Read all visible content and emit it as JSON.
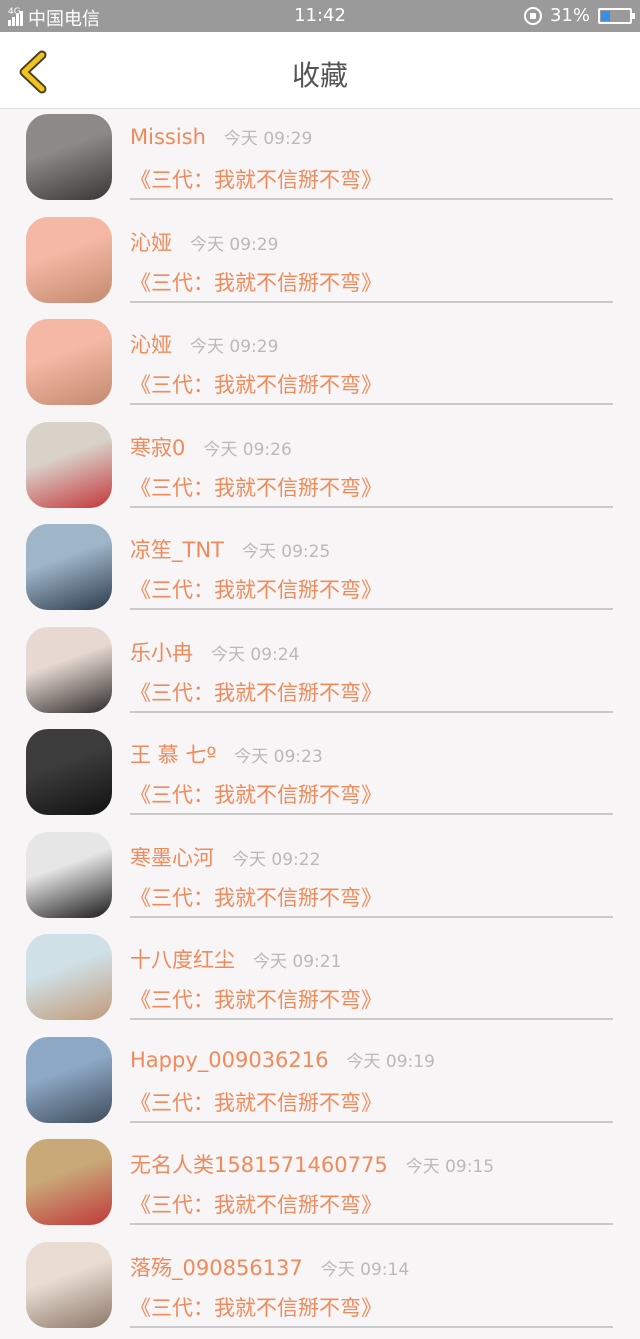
{
  "status_bar": {
    "network": "4G",
    "carrier": "中国电信",
    "time": "11:42",
    "battery": "31%",
    "battery_level": 0.31
  },
  "header": {
    "title": "收藏",
    "accent_color": "#f0c420"
  },
  "favorites": [
    {
      "name": "Missish",
      "time": "今天 09:29",
      "book": "《三代：我就不信掰不弯》",
      "avatar_colors": [
        "#8b8a86",
        "#3a3633"
      ]
    },
    {
      "name": "沁娅",
      "time": "今天 09:29",
      "book": "《三代：我就不信掰不弯》",
      "avatar_colors": [
        "#f4b8a4",
        "#c28a6f"
      ]
    },
    {
      "name": "沁娅",
      "time": "今天 09:29",
      "book": "《三代：我就不信掰不弯》",
      "avatar_colors": [
        "#f4b8a4",
        "#c28a6f"
      ]
    },
    {
      "name": "寒寂0",
      "time": "今天 09:26",
      "book": "《三代：我就不信掰不弯》",
      "avatar_colors": [
        "#d9d2c9",
        "#c4363a"
      ]
    },
    {
      "name": "凉笙_TNT",
      "time": "今天 09:25",
      "book": "《三代：我就不信掰不弯》",
      "avatar_colors": [
        "#9fb6c8",
        "#2c3b4c"
      ]
    },
    {
      "name": "乐小冉",
      "time": "今天 09:24",
      "book": "《三代：我就不信掰不弯》",
      "avatar_colors": [
        "#e7d9d2",
        "#2e2b2a"
      ]
    },
    {
      "name": "王 慕 七º",
      "time": "今天 09:23",
      "book": "《三代：我就不信掰不弯》",
      "avatar_colors": [
        "#3c3c3c",
        "#111111"
      ]
    },
    {
      "name": "寒墨心河",
      "time": "今天 09:22",
      "book": "《三代：我就不信掰不弯》",
      "avatar_colors": [
        "#e6e6e6",
        "#1a1a1a"
      ]
    },
    {
      "name": "十八度红尘",
      "time": "今天 09:21",
      "book": "《三代：我就不信掰不弯》",
      "avatar_colors": [
        "#cfe0e6",
        "#c29a7a"
      ]
    },
    {
      "name": "Happy_009036216",
      "time": "今天 09:19",
      "book": "《三代：我就不信掰不弯》",
      "avatar_colors": [
        "#8ea9c6",
        "#3f4c5b"
      ]
    },
    {
      "name": "无名人类1581571460775",
      "time": "今天 09:15",
      "book": "《三代：我就不信掰不弯》",
      "avatar_colors": [
        "#c9a978",
        "#c0393b"
      ]
    },
    {
      "name": "落殇_090856137",
      "time": "今天 09:14",
      "book": "《三代：我就不信掰不弯》",
      "avatar_colors": [
        "#e9ddd3",
        "#8b7767"
      ]
    }
  ]
}
